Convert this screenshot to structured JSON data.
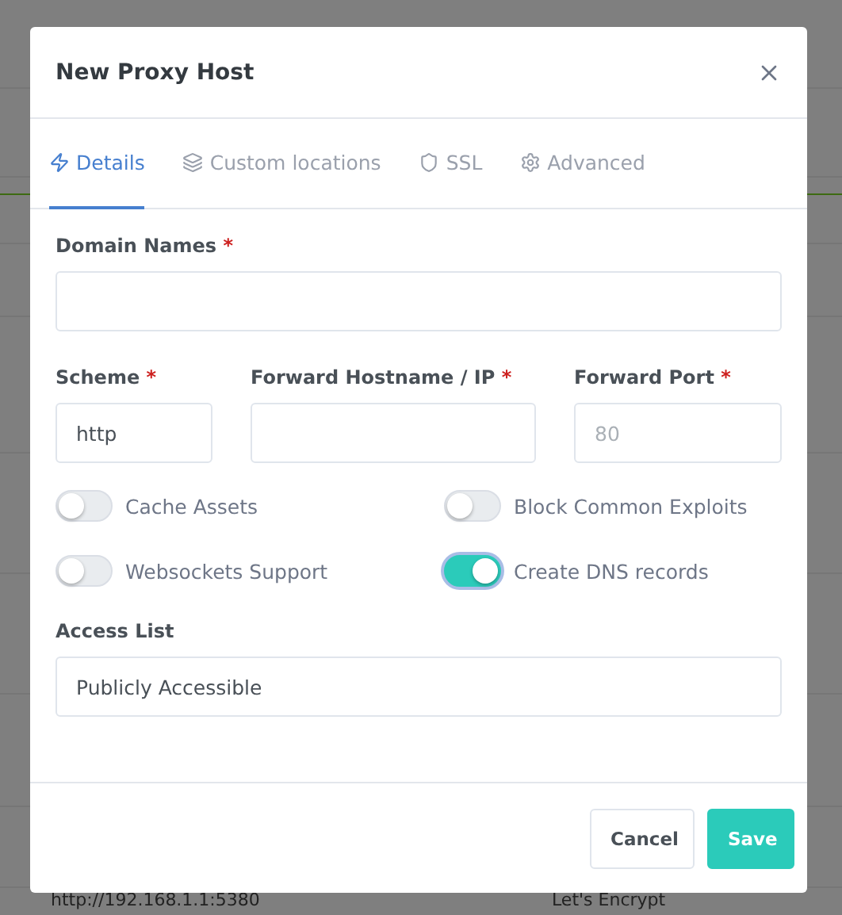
{
  "background": {
    "rows": [
      {
        "column_1": "http://192.168.1.1:5380",
        "column_2": "Let's Encrypt"
      }
    ]
  },
  "dialog": {
    "title": "New Proxy Host",
    "tabs": [
      {
        "label": "Details",
        "kind": "zap",
        "selected": true
      },
      {
        "label": "Custom locations",
        "kind": "layers",
        "selected": false
      },
      {
        "label": "SSL",
        "kind": "shield",
        "selected": false
      },
      {
        "label": "Advanced",
        "kind": "gear",
        "selected": false
      }
    ],
    "domain_names": {
      "label": "Domain Names",
      "required_mark": "*"
    },
    "fields": [
      {
        "label": "Scheme",
        "required_mark": "*",
        "value": "http"
      },
      {
        "label": "Forward Hostname / IP",
        "required_mark": "*"
      },
      {
        "label": "Forward Port",
        "required_mark": "*",
        "placeholder": "80"
      }
    ],
    "toggles": [
      {
        "label": "Cache Assets",
        "on": false
      },
      {
        "label": "Block Common Exploits",
        "on": false
      },
      {
        "label": "Websockets Support",
        "on": false
      },
      {
        "label": "Create DNS records",
        "on": true
      }
    ],
    "access_list": {
      "label": "Access List",
      "value": "Publicly Accessible"
    },
    "buttons": [
      {
        "label": "Cancel",
        "kind": "secondary"
      },
      {
        "label": "Save",
        "kind": "primary"
      }
    ]
  }
}
